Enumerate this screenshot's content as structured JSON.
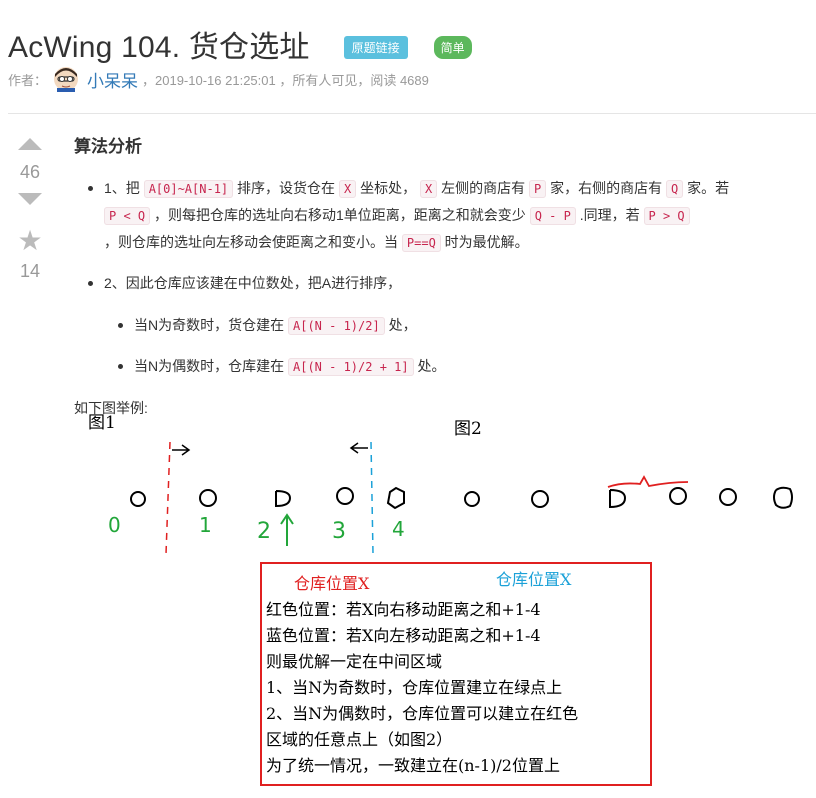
{
  "header": {
    "title": "AcWing 104. 货仓选址",
    "tag_link": "原题链接",
    "tag_difficulty": "简单"
  },
  "meta": {
    "author_prefix": "作者：",
    "author_name": "小呆呆",
    "info": "，2019-10-16 21:25:01 ，所有人可见，阅读 4689"
  },
  "vote": {
    "count": "46",
    "stars": "14"
  },
  "article": {
    "section_title": "算法分析",
    "p1": {
      "t1": "1、把 ",
      "c1": "A[0]~A[N-1]",
      "t2": " 排序，设货仓在 ",
      "c2": "X",
      "t3": " 坐标处， ",
      "c3": "X",
      "t4": " 左侧的商店有 ",
      "c4": "P",
      "t5": " 家，右侧的商店有 ",
      "c5": "Q",
      "t6": " 家。若",
      "c6": "P < Q",
      "t7": " ，则每把仓库的选址向右移动1单位距离，距离之和就会变少 ",
      "c7": "Q - P",
      "t8": " .同理，若 ",
      "c8": "P > Q",
      "t9": " ，则仓库的选址向左移动会使距离之和变小。当 ",
      "c9": "P==Q",
      "t10": " 时为最优解。"
    },
    "p2": "2、因此仓库应该建在中位数处，把A进行排序，",
    "odd": {
      "t1": "当N为奇数时，货仓建在 ",
      "c1": "A[(N - 1)/2]",
      "t2": " 处，"
    },
    "even": {
      "t1": "当N为偶数时，仓库建在 ",
      "c1": "A[(N - 1)/2 + 1]",
      "t2": " 处。"
    },
    "example_intro": "如下图举例:"
  },
  "figure": {
    "fig1_label": "图1",
    "fig2_label": "图2",
    "point_labels": [
      "0",
      "1",
      "2",
      "3",
      "4"
    ],
    "box_red_heading": "仓库位置X",
    "box_blue_heading": "仓库位置X",
    "box_lines": [
      "红色位置：若X向右移动距离之和+1-4",
      "蓝色位置：若X向左移动距离之和+1-4",
      "则最优解一定在中间区域",
      "1、当N为奇数时，仓库位置建立在绿点上",
      "2、当N为偶数时，仓库位置可以建立在红色",
      "区域的任意点上（如图2）",
      "为了统一情况，一致建立在(n-1)/2位置上"
    ],
    "colors": {
      "red": "#e02020",
      "blue": "#1ba1d8",
      "green": "#22a63a"
    }
  }
}
